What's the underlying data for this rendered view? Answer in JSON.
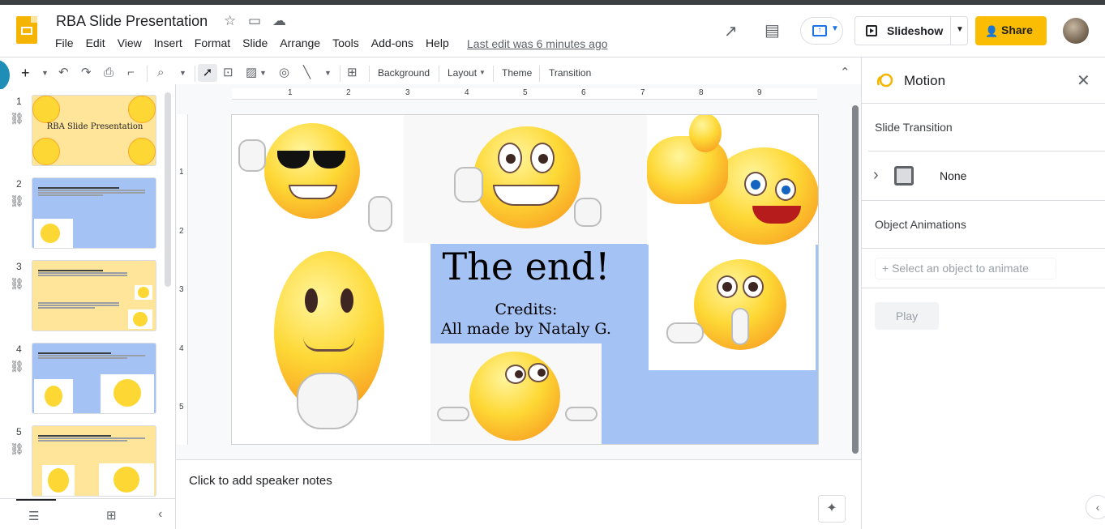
{
  "doc": {
    "title": "RBA Slide Presentation",
    "last_edit": "Last edit was 6 minutes ago"
  },
  "menu": [
    "File",
    "Edit",
    "View",
    "Insert",
    "Format",
    "Slide",
    "Arrange",
    "Tools",
    "Add-ons",
    "Help"
  ],
  "header": {
    "slideshow_label": "Slideshow",
    "share_label": "Share"
  },
  "toolbar": {
    "background": "Background",
    "layout": "Layout",
    "theme": "Theme",
    "transition": "Transition"
  },
  "ruler": {
    "h": [
      "1",
      "2",
      "3",
      "4",
      "5",
      "6",
      "7",
      "8",
      "9"
    ],
    "v": [
      "1",
      "2",
      "3",
      "4",
      "5"
    ]
  },
  "filmstrip": {
    "slides": [
      {
        "num": "1",
        "title": "RBA Slide Presentation"
      },
      {
        "num": "2",
        "title": ""
      },
      {
        "num": "3",
        "title": ""
      },
      {
        "num": "4",
        "title": ""
      },
      {
        "num": "5",
        "title": ""
      }
    ]
  },
  "slide": {
    "title": "The end!",
    "credits_1": "Credits:",
    "credits_2": "All made by Nataly G."
  },
  "notes": {
    "placeholder": "Click to add speaker notes"
  },
  "panel": {
    "title": "Motion",
    "slide_transition": "Slide Transition",
    "transition_value": "None",
    "object_animations": "Object Animations",
    "select_placeholder": "Select an object to animate",
    "play": "Play"
  },
  "colors": {
    "accent": "#fbbc04",
    "slide_blue": "#a4c2f4",
    "thumb_yellow": "#ffe599"
  }
}
